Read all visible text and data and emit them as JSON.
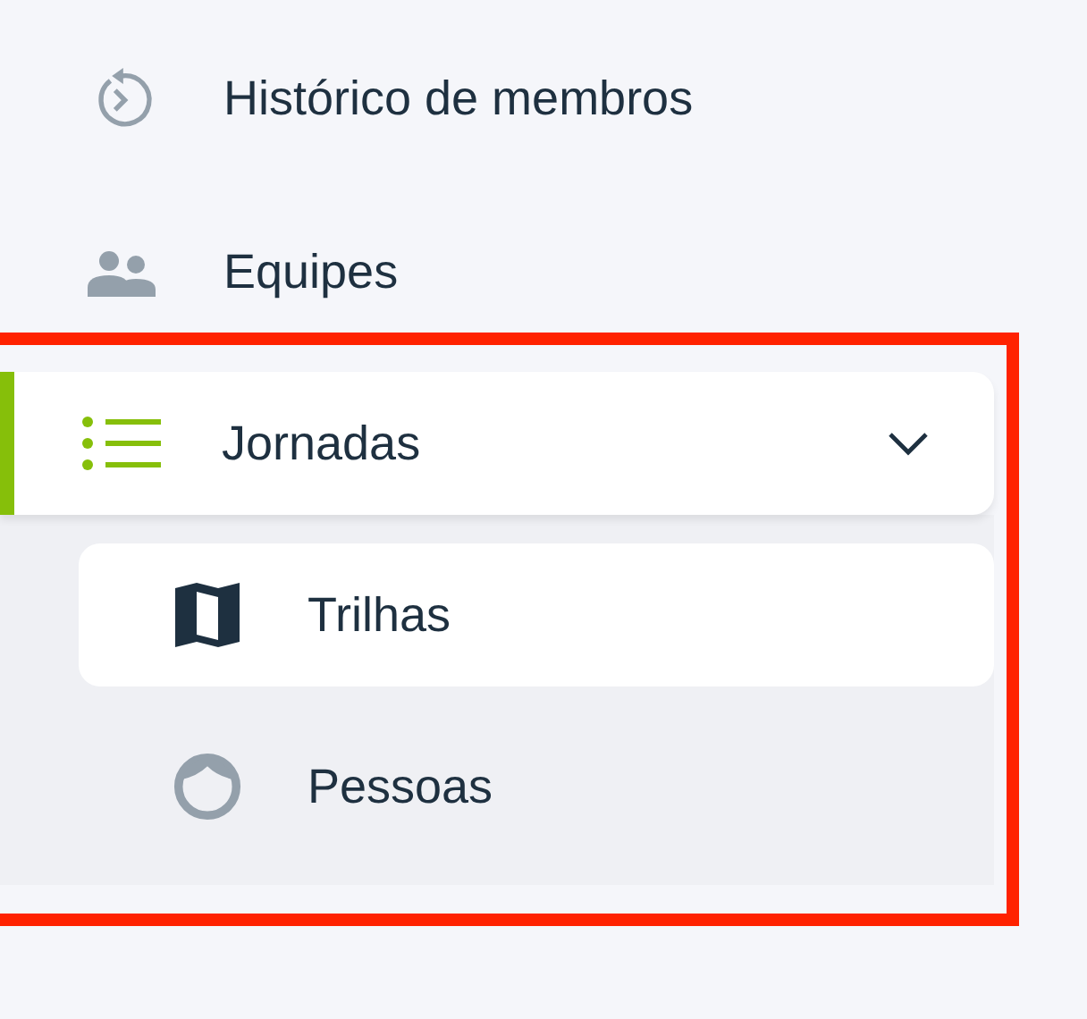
{
  "menu": [
    {
      "label": "Histórico de membros",
      "kind": "history",
      "selected": false
    },
    {
      "label": "Equipes",
      "kind": "team",
      "selected": false
    },
    {
      "label": "Jornadas",
      "kind": "list",
      "selected": true,
      "expanded": true,
      "highlighted": true,
      "children": [
        {
          "label": "Trilhas",
          "kind": "map",
          "selected": true
        },
        {
          "label": "Pessoas",
          "kind": "face",
          "selected": false
        }
      ]
    }
  ]
}
